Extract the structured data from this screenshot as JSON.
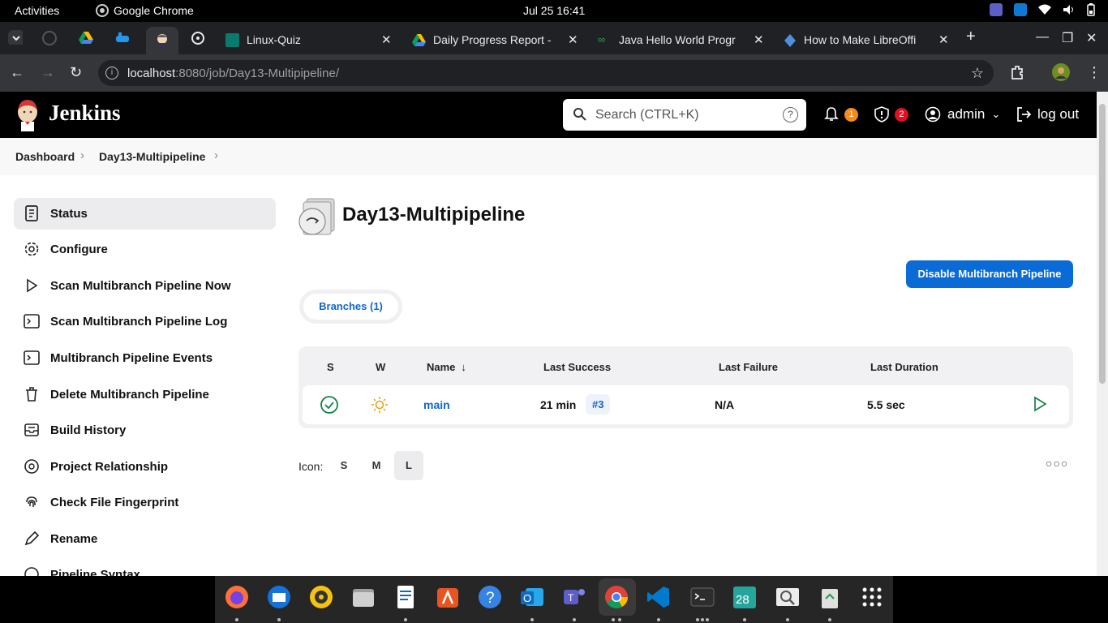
{
  "system": {
    "activities": "Activities",
    "app_name": "Google Chrome",
    "clock": "Jul 25  16:41"
  },
  "browser": {
    "tabs": [
      {
        "label": "Linux-Quiz"
      },
      {
        "label": "Daily Progress Report -"
      },
      {
        "label": "Java Hello World Progr"
      },
      {
        "label": "How to Make LibreOffi"
      }
    ],
    "new_tab": "+",
    "url_host": "localhost",
    "url_path": ":8080/job/Day13-Multipipeline/"
  },
  "jenkins": {
    "brand": "Jenkins",
    "search_placeholder": "Search (CTRL+K)",
    "help": "?",
    "notifications_count": "1",
    "security_count": "2",
    "user": "admin",
    "logout": "log out",
    "colors": {
      "notif_badge": "#f48c1b",
      "security_badge": "#e0101f",
      "primary": "#0b6bd6"
    }
  },
  "breadcrumb": {
    "items": [
      "Dashboard",
      "Day13-Multipipeline"
    ]
  },
  "sidebar": {
    "items": [
      {
        "label": "Status",
        "icon": "document-icon"
      },
      {
        "label": "Configure",
        "icon": "gear-icon"
      },
      {
        "label": "Scan Multibranch Pipeline Now",
        "icon": "play-icon"
      },
      {
        "label": "Scan Multibranch Pipeline Log",
        "icon": "terminal-icon"
      },
      {
        "label": "Multibranch Pipeline Events",
        "icon": "terminal-icon"
      },
      {
        "label": "Delete Multibranch Pipeline",
        "icon": "trash-icon"
      },
      {
        "label": "Build History",
        "icon": "inbox-icon"
      },
      {
        "label": "Project Relationship",
        "icon": "relationship-icon"
      },
      {
        "label": "Check File Fingerprint",
        "icon": "fingerprint-icon"
      },
      {
        "label": "Rename",
        "icon": "pencil-icon"
      },
      {
        "label": "Pipeline Syntax",
        "icon": "help-icon"
      }
    ]
  },
  "main": {
    "title": "Day13-Multipipeline",
    "disable_button": "Disable Multibranch Pipeline",
    "branches_tab": "Branches (1)",
    "table": {
      "headers": {
        "s": "S",
        "w": "W",
        "name": "Name",
        "sort": "↓",
        "last_success": "Last Success",
        "last_failure": "Last Failure",
        "last_duration": "Last Duration"
      },
      "rows": [
        {
          "name": "main",
          "last_success": "21 min",
          "build": "#3",
          "last_failure": "N/A",
          "last_duration": "5.5 sec"
        }
      ]
    },
    "icon_label": "Icon:",
    "icon_sizes": [
      "S",
      "M",
      "L"
    ],
    "selected_size": "L",
    "more": "○○○"
  }
}
